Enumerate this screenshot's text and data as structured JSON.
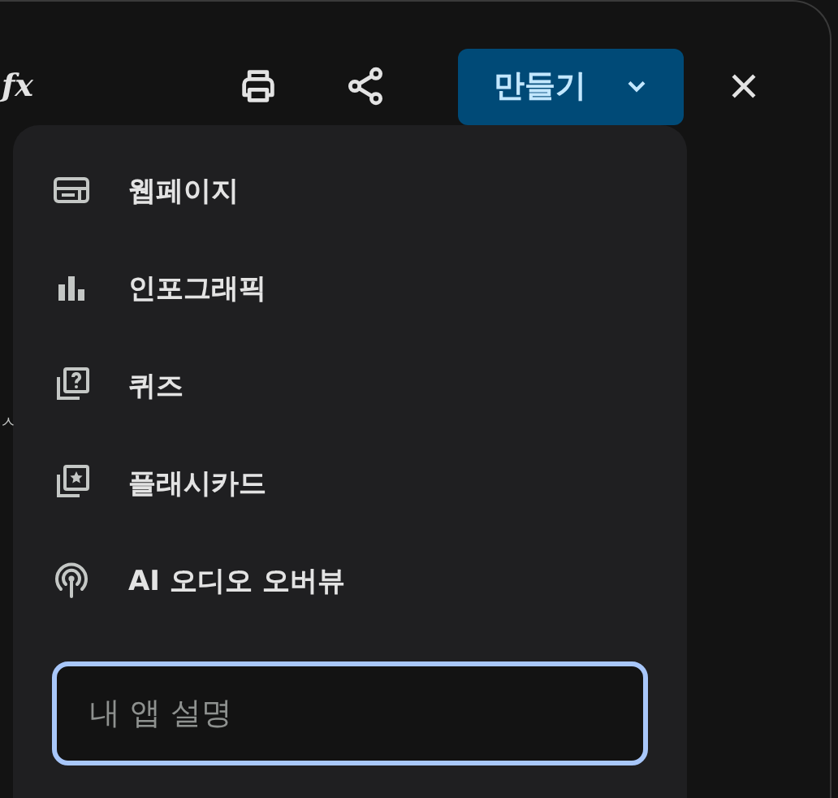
{
  "header": {
    "logo_text": "fx",
    "create_button": {
      "label": "만들기"
    }
  },
  "background_text": "ㅅ",
  "create_menu": {
    "items": [
      {
        "kind": "webpage",
        "label": "웹페이지"
      },
      {
        "kind": "infographic",
        "label": "인포그래픽"
      },
      {
        "kind": "quiz",
        "label": "퀴즈"
      },
      {
        "kind": "flashcard",
        "label": "플래시카드"
      },
      {
        "kind": "audio",
        "label": "AI 오디오 오버뷰"
      }
    ],
    "input": {
      "placeholder": "내 앱 설명"
    }
  }
}
